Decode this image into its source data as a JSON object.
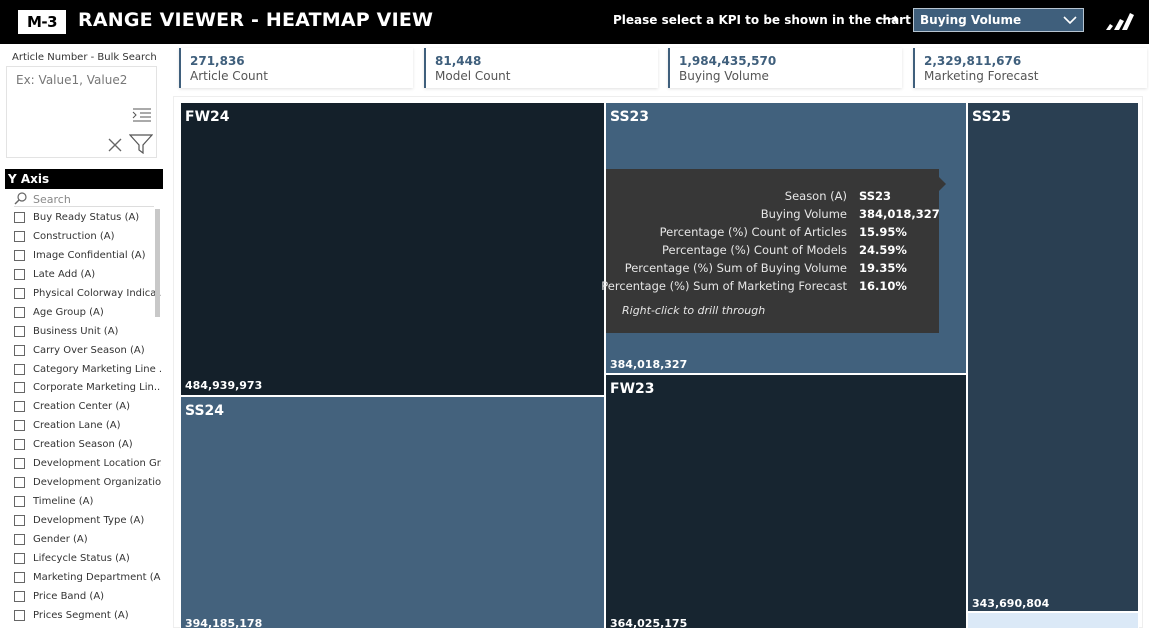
{
  "header": {
    "logo_text": "M-3",
    "title": "RANGE VIEWER - HEATMAP VIEW",
    "kpi_prompt": "Please select a KPI to be shown in the chart",
    "kpi_selected": "Buying Volume",
    "arrow_glyph": "⟶",
    "icons": {
      "brand": "adidas-logo-icon",
      "dropdown": "chevron-down-icon",
      "arrow": "arrow-right-icon"
    }
  },
  "filters": {
    "bulk_search_label": "Article Number - Bulk Search",
    "bulk_search_placeholder": "Ex: Value1, Value2",
    "y_axis_title": "Y Axis",
    "search_placeholder": "Search",
    "y_axis_items": [
      "Buy Ready Status (A)",
      "Construction (A)",
      "Image Confidential (A)",
      "Late Add (A)",
      "Physical Colorway Indica...",
      "Age Group (A)",
      "Business Unit (A)",
      "Carry Over Season (A)",
      "Category Marketing Line ...",
      "Corporate Marketing Lin...",
      "Creation Center (A)",
      "Creation Lane (A)",
      "Creation Season (A)",
      "Development Location Gr...",
      "Development Organizatio...",
      "Timeline (A)",
      "Development Type (A)",
      "Gender (A)",
      "Lifecycle Status (A)",
      "Marketing Department (A)",
      "Price Band (A)",
      "Prices Segment (A)"
    ]
  },
  "kpis": [
    {
      "value": "271,836",
      "label": "Article Count"
    },
    {
      "value": "81,448",
      "label": "Model Count"
    },
    {
      "value": "1,984,435,570",
      "label": "Buying Volume"
    },
    {
      "value": "2,329,811,676",
      "label": "Marketing Forecast"
    }
  ],
  "treemap": {
    "tiles": [
      {
        "season": "FW24",
        "value": "484,939,973",
        "color": "#14202a"
      },
      {
        "season": "SS23",
        "value": "384,018,327",
        "color": "#41617d"
      },
      {
        "season": "SS25",
        "value": "343,690,804",
        "color": "#2a3f52"
      },
      {
        "season": "SS24",
        "value": "394,185,178",
        "color": "#44627d"
      },
      {
        "season": "FW23",
        "value": "364,025,175",
        "color": "#172530"
      }
    ]
  },
  "tooltip": {
    "rows": [
      {
        "key": "Season (A)",
        "value": "SS23"
      },
      {
        "key": "Buying Volume",
        "value": "384,018,327"
      },
      {
        "key": "Percentage (%) Count of Articles",
        "value": "15.95%"
      },
      {
        "key": "Percentage (%) Count of Models",
        "value": "24.59%"
      },
      {
        "key": "Percentage (%) Sum of Buying Volume",
        "value": "19.35%"
      },
      {
        "key": "Percentage (%) Sum of Marketing Forecast",
        "value": "16.10%"
      }
    ],
    "hint": "Right-click to drill through"
  },
  "colors": {
    "accent": "#3f5f7c",
    "header_bg": "#000000",
    "tooltip_bg": "#373737"
  }
}
